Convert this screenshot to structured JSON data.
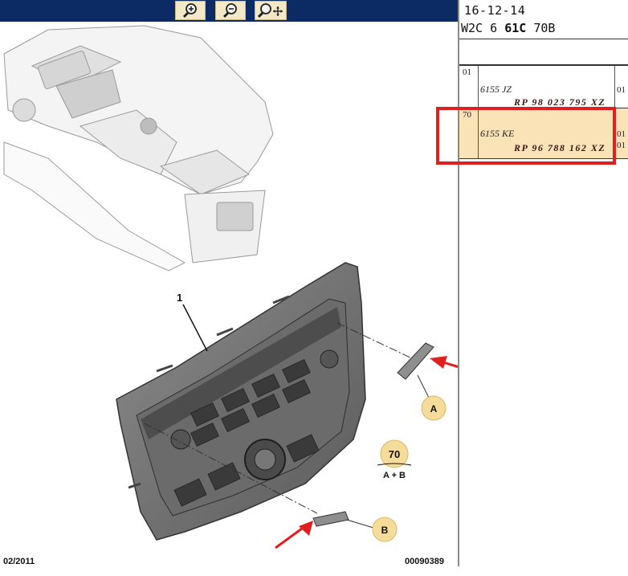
{
  "toolbar": {
    "zoom_in_icon": "zoom-in-icon",
    "zoom_out_icon": "zoom-out-icon",
    "pan_zoom_icon": "zoom-move-icon"
  },
  "header": {
    "date": "16-12-14",
    "model_code": "W2C 6",
    "model_bold": "61C",
    "model_suffix": "70B"
  },
  "parts": [
    {
      "num": "01",
      "code": "6155 JZ",
      "ref": "RP 98 023 795 XZ",
      "side": [
        "01"
      ]
    },
    {
      "num": "70",
      "code": "6155 KE",
      "ref": "RP 96 788 162 XZ",
      "side": [
        "01",
        "01"
      ]
    }
  ],
  "diagram": {
    "part_label": "1",
    "callout_a": "A",
    "callout_b": "B",
    "badge_num": "70",
    "badge_sub": "A + B"
  },
  "footer": {
    "date": "02/2011",
    "ref": "00090389"
  },
  "colors": {
    "toolbar_bg": "#0c2a63",
    "highlight_row": "#fbe3b8",
    "red_box": "#e02020",
    "callout_fill": "#f6dc9a"
  }
}
